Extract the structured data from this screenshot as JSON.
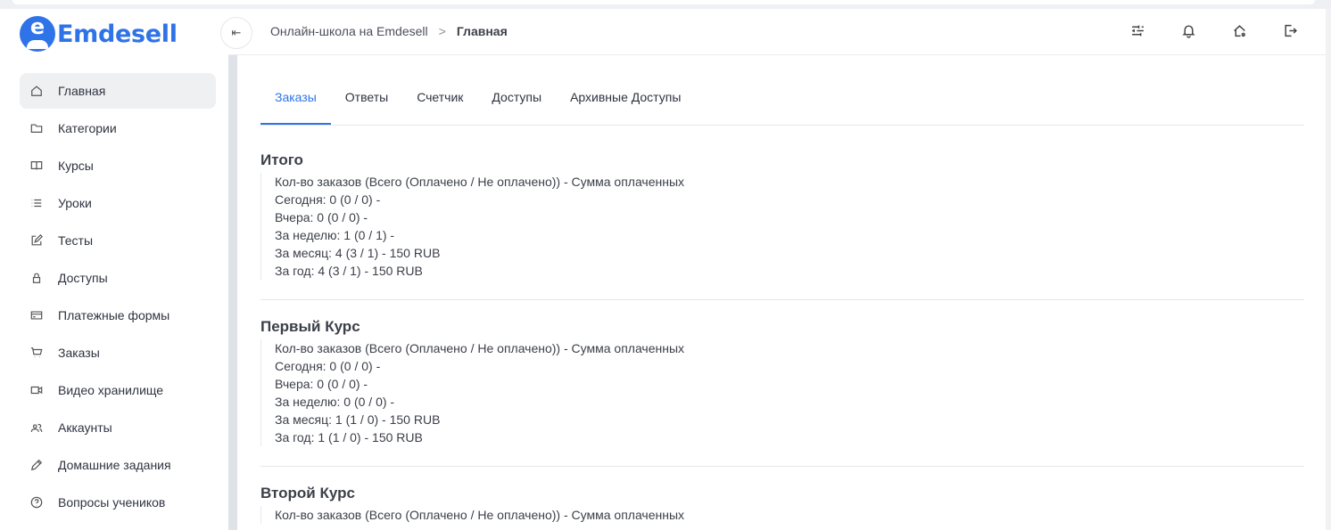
{
  "brand": {
    "name": "Emdesell",
    "mark_letter": "e",
    "color": "#2f73e8"
  },
  "header": {
    "collapse_icon": "collapse-left-icon",
    "breadcrumb": [
      "Онлайн-школа на Emdesell",
      "Главная"
    ],
    "breadcrumb_sep": ">",
    "icons": [
      "settings-sliders-icon",
      "bell-icon",
      "home-settings-icon",
      "logout-icon"
    ]
  },
  "sidebar": {
    "items": [
      {
        "label": "Главная",
        "icon": "home-icon",
        "active": true
      },
      {
        "label": "Категории",
        "icon": "folder-icon"
      },
      {
        "label": "Курсы",
        "icon": "book-icon"
      },
      {
        "label": "Уроки",
        "icon": "list-icon"
      },
      {
        "label": "Тесты",
        "icon": "edit-icon"
      },
      {
        "label": "Доступы",
        "icon": "lock-icon"
      },
      {
        "label": "Платежные формы",
        "icon": "credit-card-icon"
      },
      {
        "label": "Заказы",
        "icon": "cart-icon"
      },
      {
        "label": "Видео хранилище",
        "icon": "video-icon"
      },
      {
        "label": "Аккаунты",
        "icon": "users-icon"
      },
      {
        "label": "Домашние задания",
        "icon": "pencil-icon"
      },
      {
        "label": "Вопросы учеников",
        "icon": "question-icon"
      }
    ]
  },
  "tabs": [
    "Заказы",
    "Ответы",
    "Счетчик",
    "Доступы",
    "Архивные Доступы"
  ],
  "active_tab": "Заказы",
  "sections": [
    {
      "title": "Итого",
      "lines": [
        "Кол-во заказов (Всего (Оплачено / Не оплачено)) - Сумма оплаченных",
        "Сегодня: 0 (0 / 0) -",
        "Вчера: 0 (0 / 0) -",
        "За неделю: 1 (0 / 1) -",
        "За месяц: 4 (3 / 1) - 150 RUB",
        "За год: 4 (3 / 1) - 150 RUB"
      ]
    },
    {
      "title": "Первый Курс",
      "lines": [
        "Кол-во заказов (Всего (Оплачено / Не оплачено)) - Сумма оплаченных",
        "Сегодня: 0 (0 / 0) -",
        "Вчера: 0 (0 / 0) -",
        "За неделю: 0 (0 / 0) -",
        "За месяц: 1 (1 / 0) - 150 RUB",
        "За год: 1 (1 / 0) - 150 RUB"
      ]
    },
    {
      "title": "Второй Курс",
      "lines": [
        "Кол-во заказов (Всего (Оплачено / Не оплачено)) - Сумма оплаченных"
      ]
    }
  ]
}
